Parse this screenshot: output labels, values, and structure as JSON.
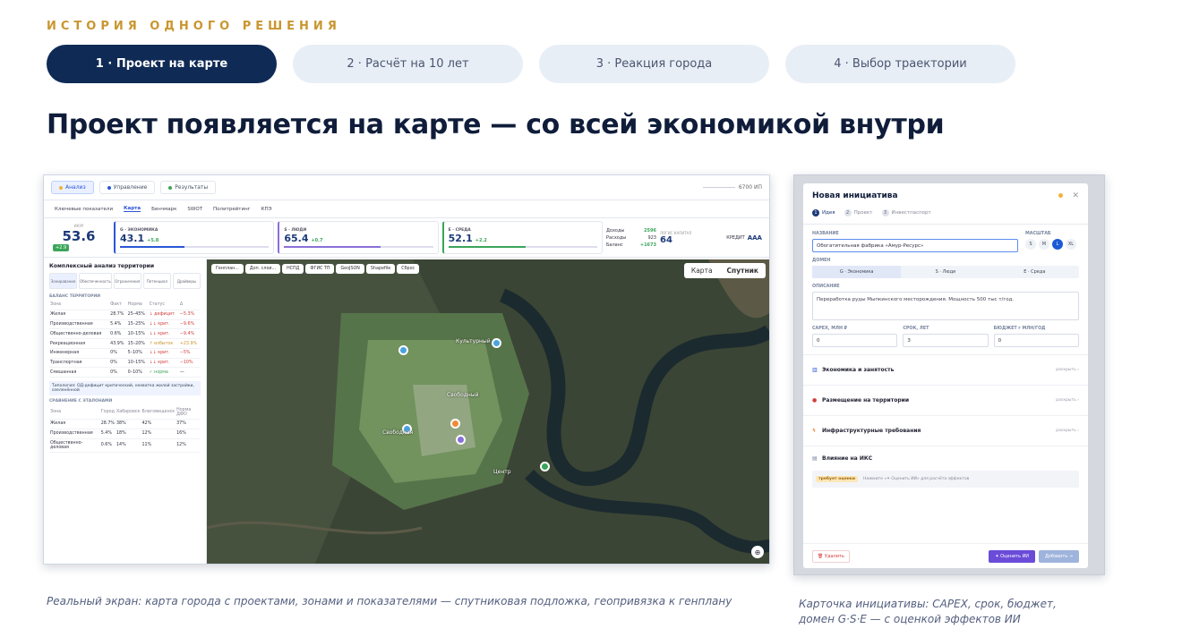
{
  "eyebrow": "ИСТОРИЯ ОДНОГО РЕШЕНИЯ",
  "steps": [
    {
      "label": "1 · Проект на карте",
      "active": true
    },
    {
      "label": "2 · Расчёт на 10 лет",
      "active": false
    },
    {
      "label": "3 · Реакция города",
      "active": false
    },
    {
      "label": "4 · Выбор траектории",
      "active": false
    }
  ],
  "headline": "Проект появляется на карте — со всей экономикой внутри",
  "screen": {
    "tabs": [
      "Анализ",
      "Управление",
      "Результаты"
    ],
    "top_right": "6700 ИП",
    "subtabs": [
      "Ключевые показатели",
      "Карта",
      "Бенчмарк",
      "SWOT",
      "Политрейтинг",
      "КПЭ"
    ],
    "kpi_main": {
      "label": "ИКУР",
      "value": "53.6",
      "delta": "+2.9"
    },
    "kpi_cards": [
      {
        "cap": "G · ЭКОНОМИКА",
        "value": "43.1",
        "delta": "+5.8"
      },
      {
        "cap": "S · ЛЮДИ",
        "value": "65.4",
        "delta": "+0.7"
      },
      {
        "cap": "E · СРЕДА",
        "value": "52.1",
        "delta": "+2.2"
      }
    ],
    "kpi_fin": [
      {
        "label": "Доходы",
        "value": "2596"
      },
      {
        "label": "Расходы",
        "value": "923"
      },
      {
        "label": "Баланс",
        "value": "+1673"
      }
    ],
    "kpi_cap": {
      "label": "ЛОГИС КАПИТАЛ",
      "value": "64"
    },
    "kpi_credit": {
      "label": "КРЕДИТ",
      "value": "ААА"
    },
    "left_title": "Комплексный анализ территории",
    "modes": [
      "Зонирование",
      "Обеспеченность",
      "Ограничения",
      "Потенциал",
      "Драйверы"
    ],
    "balance_title": "БАЛАНС ТЕРРИТОРИИ",
    "balance_head": [
      "Зона",
      "Факт",
      "Норма",
      "Статус",
      "Δ"
    ],
    "balance_rows": [
      [
        "Жилая",
        "28.7%",
        "25–45%",
        "↓ дефицит",
        "−5.3%"
      ],
      [
        "Производственная",
        "5.4%",
        "15–25%",
        "↓↓ крит.",
        "−9.6%"
      ],
      [
        "Общественно-деловая",
        "0.6%",
        "10–15%",
        "↓↓ крит.",
        "−9.4%"
      ],
      [
        "Рекреационная",
        "43.9%",
        "15–20%",
        "↑ избыток",
        "+23.9%"
      ],
      [
        "Инженерная",
        "0%",
        "5–10%",
        "↓↓ крит.",
        "−5%"
      ],
      [
        "Транспортная",
        "0%",
        "10–15%",
        "↓↓ крит.",
        "−10%"
      ],
      [
        "Смешанная",
        "0%",
        "0–10%",
        "✓ норма",
        "—"
      ]
    ],
    "note": "Типология: ОД-дефицит критический, нехватка жилой застройки, озеленённой",
    "compare_title": "СРАВНЕНИЕ С ЭТАЛОНАМИ",
    "compare_head": [
      "Зона",
      "Город",
      "Хабаровск",
      "Благовещенск",
      "Норма ДФО"
    ],
    "compare_rows": [
      [
        "Жилая",
        "28.7%",
        "38%",
        "42%",
        "37%"
      ],
      [
        "Производственная",
        "5.4%",
        "18%",
        "12%",
        "16%"
      ],
      [
        "Общественно-деловая",
        "0.6%",
        "14%",
        "11%",
        "12%"
      ]
    ],
    "map_tools": [
      "Генплан...",
      "Доп. слои...",
      "НСПД",
      "ФГИС ТП",
      "GeoJSON",
      "Shapefile",
      "Сброс"
    ],
    "map_switch": [
      "Карта",
      "Спутник"
    ],
    "map_places": [
      "Культурный",
      "Свободный",
      "Свободная",
      "Центр"
    ]
  },
  "caption_left": "Реальный экран: карта города с проектами, зонами и показателями — спутниковая подложка, геопривязка к генплану",
  "modal": {
    "title": "Новая инициатива",
    "steps": [
      "Идея",
      "Проект",
      "Инвестпаспорт"
    ],
    "name_label": "НАЗВАНИЕ",
    "name_value": "Обогатительная фабрика «Амур-Ресурс»",
    "scale_label": "МАСШТАБ",
    "scales": [
      "S",
      "M",
      "L",
      "XL"
    ],
    "domain_label": "ДОМЕН",
    "domains": [
      "G · Экономика",
      "S · Люди",
      "E · Среда"
    ],
    "desc_label": "ОПИСАНИЕ",
    "desc_value": "Переработка руды Мыпкинского месторождения. Мощность 500 тыс т/год.",
    "capex_label": "CAPEX, МЛН ₽",
    "capex_value": "0",
    "term_label": "СРОК, ЛЕТ",
    "term_value": "3",
    "budget_label": "БЮДЖЕТ г МЛН/ГОД",
    "budget_value": "0",
    "sections": [
      "Экономика и занятость",
      "Размещение на территории",
      "Инфраструктурные требования"
    ],
    "expand": "раскрыть ›",
    "impact_title": "Влияние на ИКС",
    "pending_badge": "требует оценки",
    "pending_text": "Нажмите «✦ Оценить ИИ» для расчёта эффектов",
    "delete": "🗑 Удалить",
    "evaluate": "✦ Оценить ИИ",
    "add": "Добавить →"
  },
  "caption_right": "Карточка инициативы: CAPEX, срок, бюджет, домен G·S·E — с оценкой эффектов ИИ",
  "colors": {
    "accent_gold": "#c9962f",
    "navy": "#0f2a55",
    "economy": "#2a56d6",
    "people": "#8a6fd8",
    "environment": "#3aa55a"
  }
}
